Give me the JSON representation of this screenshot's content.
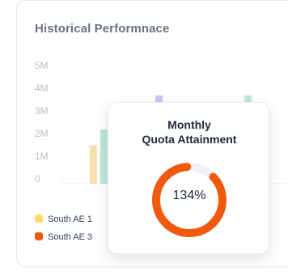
{
  "card": {
    "title": "Historical Performnace"
  },
  "chart_data": {
    "type": "bar",
    "title": "Historical Performnace",
    "yticks": [
      "5M",
      "4M",
      "3M",
      "2M",
      "1M",
      "0"
    ],
    "ylim": [
      0,
      5000000
    ],
    "series": [
      {
        "name": "South AE 1",
        "color": "#ffd96a"
      },
      {
        "name": "South AE 3",
        "color": "#f05a0f"
      }
    ],
    "bars": [
      {
        "x": 0.12,
        "value": 1700000,
        "color": "#f9dfae"
      },
      {
        "x": 0.165,
        "value": 2400000,
        "color": "#bfe8d8"
      },
      {
        "x": 0.4,
        "value": 3900000,
        "color": "#c7c8f2"
      },
      {
        "x": 0.78,
        "value": 3900000,
        "color": "#bfe8d8"
      }
    ]
  },
  "popup": {
    "title_line1": "Monthly",
    "title_line2": "Quota Attainment",
    "value_text": "134%",
    "attainment_fraction": 1.34,
    "ring_color": "#f05a0f",
    "track_color": "#eef1f5"
  }
}
